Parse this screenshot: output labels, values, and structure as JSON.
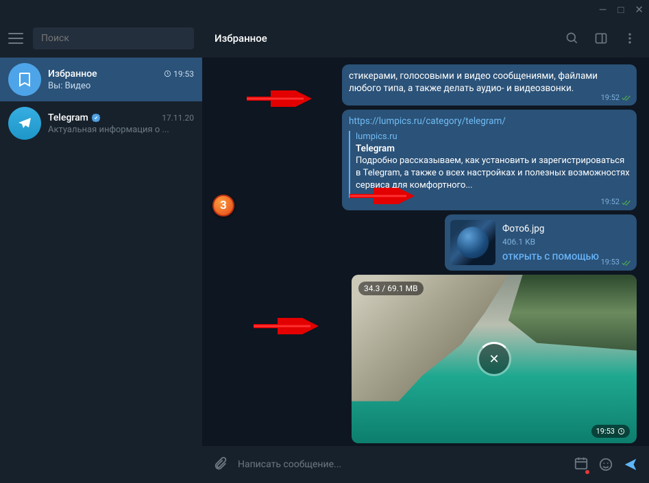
{
  "search_placeholder": "Поиск",
  "sidebar": {
    "items": [
      {
        "name": "Избранное",
        "preview": "Вы: Видео",
        "time": "19:53",
        "clock": true
      },
      {
        "name": "Telegram",
        "preview": "Актуальная информация о ...",
        "time": "17.11.20",
        "verified": true
      }
    ]
  },
  "header": {
    "title": "Избранное"
  },
  "messages": {
    "m0": {
      "text": "стикерами, голосовыми и видео сообщениями, файлами любого типа, а также делать аудио- и видеозвонки.",
      "time": "19:52"
    },
    "m1": {
      "link": "https://lumpics.ru/category/telegram/",
      "site": "lumpics.ru",
      "title": "Telegram",
      "desc": "Подробно рассказываем, как установить и зарегистрироваться в Telegram, а также о всех настройках и полезных возможностях сервиса для комфортного...",
      "time": "19:52"
    },
    "m2": {
      "fname": "Фото6.jpg",
      "fsize": "406.1 KB",
      "open": "ОТКРЫТЬ С ПОМОЩЬЮ",
      "time": "19:53"
    },
    "m3": {
      "progress": "34.3 / 69.1 MB",
      "time": "19:53"
    }
  },
  "composer": {
    "placeholder": "Написать сообщение..."
  },
  "badge": "3"
}
